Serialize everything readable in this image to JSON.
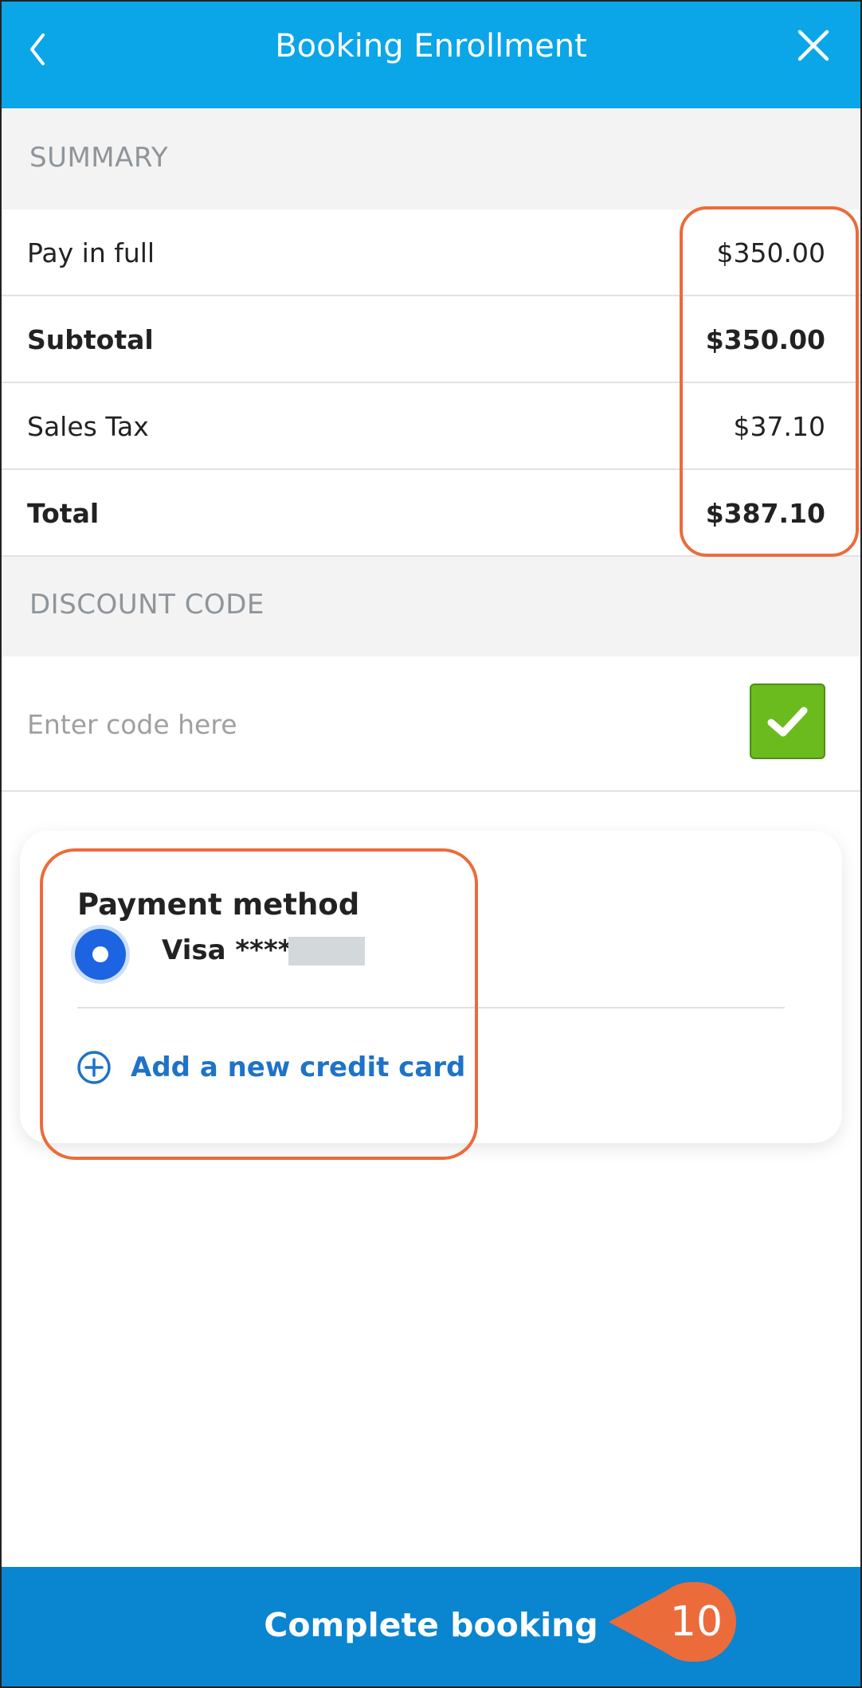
{
  "header": {
    "title": "Booking Enrollment",
    "back_icon": "chevron-left-icon",
    "close_icon": "close-icon",
    "color": "#0aa6e8"
  },
  "summary": {
    "heading": "SUMMARY",
    "rows": [
      {
        "label": "Pay in full",
        "value": "$350.00",
        "bold": false
      },
      {
        "label": "Subtotal",
        "value": "$350.00",
        "bold": true
      },
      {
        "label": "Sales Tax",
        "value": "$37.10",
        "bold": false
      },
      {
        "label": "Total",
        "value": "$387.10",
        "bold": true
      }
    ]
  },
  "discount": {
    "heading": "DISCOUNT CODE",
    "placeholder": "Enter code here",
    "value": "",
    "apply_icon": "checkmark-icon",
    "apply_color": "#6bbb1e"
  },
  "payment": {
    "title": "Payment method",
    "selected_card": "Visa ****",
    "add_card_label": "Add a new credit card",
    "add_icon": "plus-circle-icon",
    "link_color": "#1e73c8"
  },
  "footer": {
    "complete_label": "Complete booking",
    "color": "#0a85d0"
  },
  "annotation": {
    "step_number": "10",
    "color": "#ec6b3b"
  }
}
